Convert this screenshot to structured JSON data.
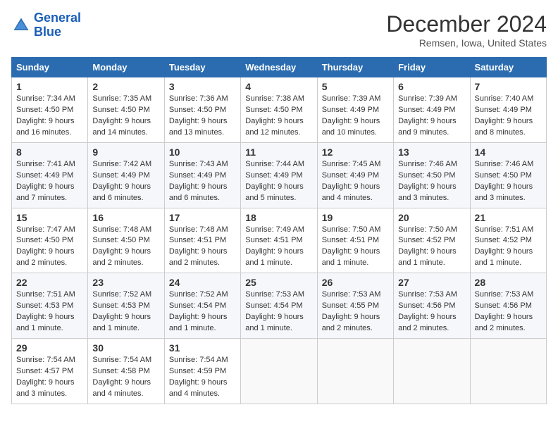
{
  "header": {
    "logo_line1": "General",
    "logo_line2": "Blue",
    "month": "December 2024",
    "location": "Remsen, Iowa, United States"
  },
  "days_of_week": [
    "Sunday",
    "Monday",
    "Tuesday",
    "Wednesday",
    "Thursday",
    "Friday",
    "Saturday"
  ],
  "weeks": [
    [
      {
        "day": 1,
        "info": "Sunrise: 7:34 AM\nSunset: 4:50 PM\nDaylight: 9 hours and 16 minutes."
      },
      {
        "day": 2,
        "info": "Sunrise: 7:35 AM\nSunset: 4:50 PM\nDaylight: 9 hours and 14 minutes."
      },
      {
        "day": 3,
        "info": "Sunrise: 7:36 AM\nSunset: 4:50 PM\nDaylight: 9 hours and 13 minutes."
      },
      {
        "day": 4,
        "info": "Sunrise: 7:38 AM\nSunset: 4:50 PM\nDaylight: 9 hours and 12 minutes."
      },
      {
        "day": 5,
        "info": "Sunrise: 7:39 AM\nSunset: 4:49 PM\nDaylight: 9 hours and 10 minutes."
      },
      {
        "day": 6,
        "info": "Sunrise: 7:39 AM\nSunset: 4:49 PM\nDaylight: 9 hours and 9 minutes."
      },
      {
        "day": 7,
        "info": "Sunrise: 7:40 AM\nSunset: 4:49 PM\nDaylight: 9 hours and 8 minutes."
      }
    ],
    [
      {
        "day": 8,
        "info": "Sunrise: 7:41 AM\nSunset: 4:49 PM\nDaylight: 9 hours and 7 minutes."
      },
      {
        "day": 9,
        "info": "Sunrise: 7:42 AM\nSunset: 4:49 PM\nDaylight: 9 hours and 6 minutes."
      },
      {
        "day": 10,
        "info": "Sunrise: 7:43 AM\nSunset: 4:49 PM\nDaylight: 9 hours and 6 minutes."
      },
      {
        "day": 11,
        "info": "Sunrise: 7:44 AM\nSunset: 4:49 PM\nDaylight: 9 hours and 5 minutes."
      },
      {
        "day": 12,
        "info": "Sunrise: 7:45 AM\nSunset: 4:49 PM\nDaylight: 9 hours and 4 minutes."
      },
      {
        "day": 13,
        "info": "Sunrise: 7:46 AM\nSunset: 4:50 PM\nDaylight: 9 hours and 3 minutes."
      },
      {
        "day": 14,
        "info": "Sunrise: 7:46 AM\nSunset: 4:50 PM\nDaylight: 9 hours and 3 minutes."
      }
    ],
    [
      {
        "day": 15,
        "info": "Sunrise: 7:47 AM\nSunset: 4:50 PM\nDaylight: 9 hours and 2 minutes."
      },
      {
        "day": 16,
        "info": "Sunrise: 7:48 AM\nSunset: 4:50 PM\nDaylight: 9 hours and 2 minutes."
      },
      {
        "day": 17,
        "info": "Sunrise: 7:48 AM\nSunset: 4:51 PM\nDaylight: 9 hours and 2 minutes."
      },
      {
        "day": 18,
        "info": "Sunrise: 7:49 AM\nSunset: 4:51 PM\nDaylight: 9 hours and 1 minute."
      },
      {
        "day": 19,
        "info": "Sunrise: 7:50 AM\nSunset: 4:51 PM\nDaylight: 9 hours and 1 minute."
      },
      {
        "day": 20,
        "info": "Sunrise: 7:50 AM\nSunset: 4:52 PM\nDaylight: 9 hours and 1 minute."
      },
      {
        "day": 21,
        "info": "Sunrise: 7:51 AM\nSunset: 4:52 PM\nDaylight: 9 hours and 1 minute."
      }
    ],
    [
      {
        "day": 22,
        "info": "Sunrise: 7:51 AM\nSunset: 4:53 PM\nDaylight: 9 hours and 1 minute."
      },
      {
        "day": 23,
        "info": "Sunrise: 7:52 AM\nSunset: 4:53 PM\nDaylight: 9 hours and 1 minute."
      },
      {
        "day": 24,
        "info": "Sunrise: 7:52 AM\nSunset: 4:54 PM\nDaylight: 9 hours and 1 minute."
      },
      {
        "day": 25,
        "info": "Sunrise: 7:53 AM\nSunset: 4:54 PM\nDaylight: 9 hours and 1 minute."
      },
      {
        "day": 26,
        "info": "Sunrise: 7:53 AM\nSunset: 4:55 PM\nDaylight: 9 hours and 2 minutes."
      },
      {
        "day": 27,
        "info": "Sunrise: 7:53 AM\nSunset: 4:56 PM\nDaylight: 9 hours and 2 minutes."
      },
      {
        "day": 28,
        "info": "Sunrise: 7:53 AM\nSunset: 4:56 PM\nDaylight: 9 hours and 2 minutes."
      }
    ],
    [
      {
        "day": 29,
        "info": "Sunrise: 7:54 AM\nSunset: 4:57 PM\nDaylight: 9 hours and 3 minutes."
      },
      {
        "day": 30,
        "info": "Sunrise: 7:54 AM\nSunset: 4:58 PM\nDaylight: 9 hours and 4 minutes."
      },
      {
        "day": 31,
        "info": "Sunrise: 7:54 AM\nSunset: 4:59 PM\nDaylight: 9 hours and 4 minutes."
      },
      null,
      null,
      null,
      null
    ]
  ]
}
